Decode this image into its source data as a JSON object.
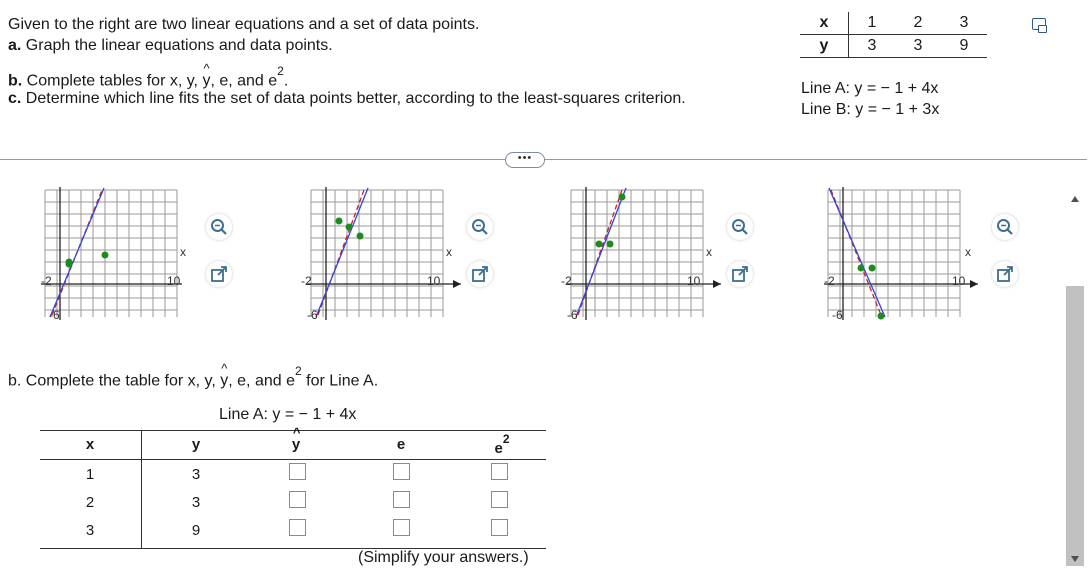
{
  "question": {
    "intro": "Given to the right are two linear equations and a set of data points.",
    "part_a_label": "a.",
    "part_a_text": "Graph the linear equations and data points.",
    "part_b_label": "b.",
    "part_b_text_pre": "Complete tables for x, y,",
    "part_b_yhat": "y",
    "part_b_text_mid": ", e, and e",
    "part_b_sup": "2",
    "part_b_text_end": ".",
    "part_c_label": "c.",
    "part_c_text": "Determine which line fits the set of data points better, according to the least-squares criterion."
  },
  "given_table": {
    "x_label": "x",
    "y_label": "y",
    "x_values": [
      "1",
      "2",
      "3"
    ],
    "y_values": [
      "3",
      "3",
      "9"
    ]
  },
  "equations": {
    "line_a": "Line A: y = − 1 + 4x",
    "line_b": "Line B: y = − 1 + 3x"
  },
  "more_button": "•••",
  "graphs": [
    {
      "tick_top": "10",
      "tick_left": "-2",
      "tick_right": "10",
      "tick_bottom": "-6",
      "axis_label": "x"
    },
    {
      "tick_top": "10",
      "tick_left": "-2",
      "tick_right": "10",
      "tick_bottom": "-6",
      "axis_label": "x"
    },
    {
      "tick_top": "10",
      "tick_left": "-2",
      "tick_right": "10",
      "tick_bottom": "-6",
      "axis_label": "x"
    },
    {
      "tick_top": "10",
      "tick_left": "-2",
      "tick_right": "10",
      "tick_bottom": "-6",
      "axis_label": "x"
    }
  ],
  "part_b": {
    "title_pre": "b. Complete the table for x, y,",
    "title_yhat": "y",
    "title_mid": ", e, and e",
    "title_sup": "2",
    "title_end": " for Line A.",
    "table_caption": "Line A: y = − 1 + 4x",
    "headers": {
      "x": "x",
      "y": "y",
      "yhat": "y",
      "e": "e",
      "e2": "e",
      "e2_sup": "2"
    },
    "rows": [
      {
        "x": "1",
        "y": "3"
      },
      {
        "x": "2",
        "y": "3"
      },
      {
        "x": "3",
        "y": "9"
      }
    ],
    "note": "(Simplify your answers.)"
  },
  "colors": {
    "blue_line": "#3344dd",
    "red_dashed": "#d02020",
    "point": "#1f8a1f",
    "input_border": "#6a8fc0"
  }
}
